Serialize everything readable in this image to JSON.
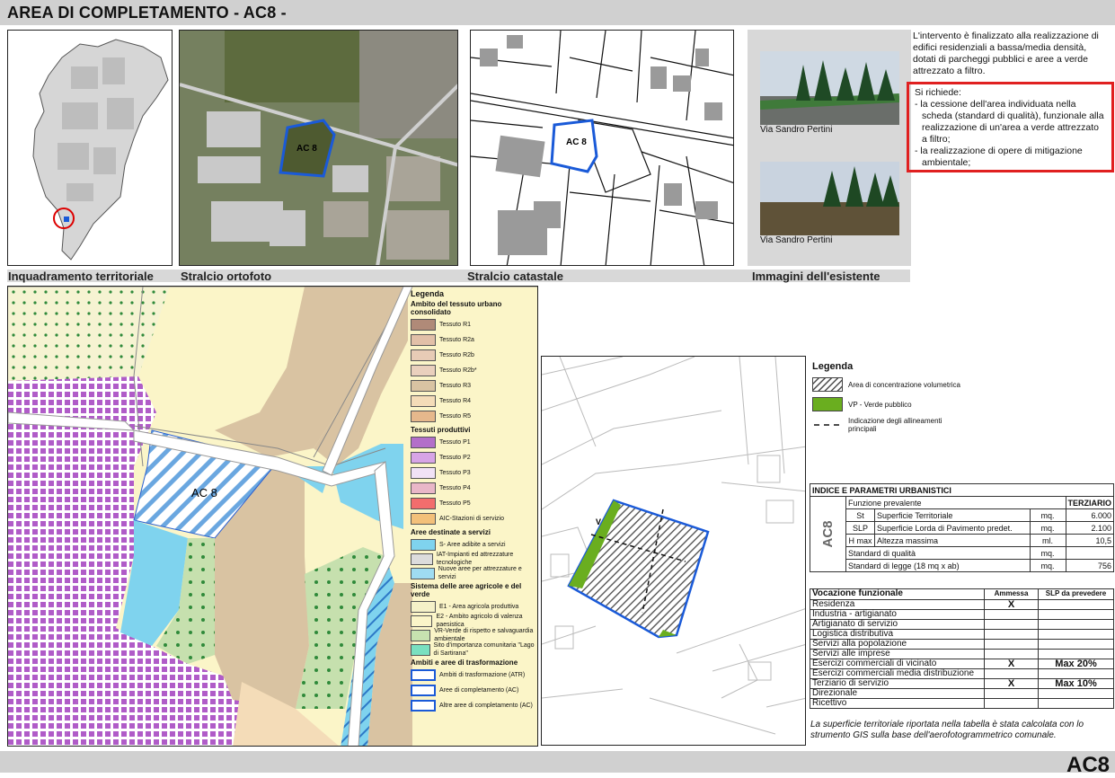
{
  "header": {
    "title": "AREA DI COMPLETAMENTO - AC8 -"
  },
  "captions": {
    "inquadramento": "Inquadramento territoriale",
    "ortofoto": "Stralcio ortofoto",
    "catastale": "Stralcio catastale",
    "esistente": "Immagini dell'esistente"
  },
  "map_labels": {
    "ortofoto": "AC 8",
    "catastale": "AC 8",
    "prg": "AC 8",
    "plan_v": "V"
  },
  "photos": [
    {
      "caption": "Via Sandro Pertini"
    },
    {
      "caption": "Via Sandro Pertini"
    }
  ],
  "description": "L'intervento è finalizzato alla realizzazione di edifici residenziali a bassa/media densità, dotati di parcheggi pubblici e aree a verde attrezzato a filtro.",
  "requirements": {
    "intro": "Si richiede:",
    "items": [
      "- la cessione dell'area individuata nella scheda (standard di qualità), funzionale alla realizzazione di un'area a verde attrezzato a filtro;",
      "- la realizzazione di opere di mitigazione ambientale;"
    ]
  },
  "legend_prg": {
    "title": "Legenda",
    "groups": [
      {
        "title": "Ambito del tessuto urbano consolidato",
        "items": [
          {
            "label": "Tessuto R1",
            "color": "#b08a78"
          },
          {
            "label": "Tessuto R2a",
            "color": "#e2c0a8"
          },
          {
            "label": "Tessuto R2b",
            "color": "#e8cbb6"
          },
          {
            "label": "Tessuto R2b*",
            "color": "#ead0bd"
          },
          {
            "label": "Tessuto R3",
            "color": "#d9c3a2"
          },
          {
            "label": "Tessuto R4",
            "color": "#f4dcb8"
          },
          {
            "label": "Tessuto R5",
            "color": "#e6b88c"
          }
        ]
      },
      {
        "title": "Tessuti produttivi",
        "items": [
          {
            "label": "Tessuto P1",
            "color": "#b36fc9"
          },
          {
            "label": "Tessuto P2",
            "color": "#d7a4e6"
          },
          {
            "label": "Tessuto P3",
            "color": "#f1e2f6"
          },
          {
            "label": "Tessuto P4",
            "color": "#e9b7c8"
          },
          {
            "label": "Tessuto P5",
            "color": "#f26d6d"
          },
          {
            "label": "AIC-Stazioni di servizio",
            "color": "#f3c07a"
          }
        ]
      },
      {
        "title": "Aree destinate a servizi",
        "items": [
          {
            "label": "S- Aree adibite a servizi",
            "color": "#7fd3ee"
          },
          {
            "label": "IAT-Impianti ed attrezzature tecnologiche",
            "color": "#dcdcdc"
          },
          {
            "label": "Nuove aree per attrezzature e servizi",
            "color": "#9fdcf2"
          }
        ]
      },
      {
        "title": "Sistema delle aree agricole e del verde",
        "items": [
          {
            "label": "E1 - Area agricola produttiva",
            "color": "#f5f1c8"
          },
          {
            "label": "E2 - Ambito agricolo di valenza paesistica",
            "color": "#fbf5c8"
          },
          {
            "label": "VR-Verde di rispetto e salvaguardia ambientale",
            "color": "#c7e2b0"
          },
          {
            "label": "Sito d'importanza comunitaria \"Lago di Sartirana\"",
            "color": "#79e0c0"
          }
        ]
      },
      {
        "title": "Ambiti e aree di trasformazione",
        "items": [
          {
            "label": "Ambiti di trasformazione (ATR)",
            "color": "#ffffff"
          },
          {
            "label": "Aree di completamento (AC)",
            "color": "#ffffff"
          },
          {
            "label": "Altre aree di completamento (AC)",
            "color": "#ffffff"
          }
        ]
      }
    ]
  },
  "legend_plan": {
    "title": "Legenda",
    "items": [
      {
        "label": "Area di concentrazione volumetrica"
      },
      {
        "label": "VP - Verde pubblico"
      },
      {
        "label": "Indicazione degli allineamenti principali"
      }
    ]
  },
  "params": {
    "title": "INDICE E PARAMETRI URBANISTICI",
    "side": "AC8",
    "funzione_label": "Funzione prevalente",
    "funzione_value": "TERZIARIO",
    "rows": [
      {
        "code": "St",
        "label": "Superficie Territoriale",
        "unit": "mq.",
        "value": "6.000"
      },
      {
        "code": "SLP",
        "label": "Superficie Lorda di Pavimento predet.",
        "unit": "mq.",
        "value": "2.100"
      },
      {
        "code": "H max",
        "label": "Altezza massima",
        "unit": "ml.",
        "value": "10,5"
      }
    ],
    "std_qualita": {
      "label": "Standard di qualità",
      "unit": "mq.",
      "value": ""
    },
    "std_legge": {
      "label": "Standard di legge (18 mq x ab)",
      "unit": "mq.",
      "value": "756"
    }
  },
  "vocazione": {
    "headers": [
      "Vocazione funzionale",
      "Ammessa",
      "SLP da prevedere"
    ],
    "rows": [
      [
        "Residenza",
        "X",
        ""
      ],
      [
        "Industria - artigianato",
        "",
        ""
      ],
      [
        "Artigianato di servizio",
        "",
        ""
      ],
      [
        "Logistica distributiva",
        "",
        ""
      ],
      [
        "Servizi alla popolazione",
        "",
        ""
      ],
      [
        "Servizi alle imprese",
        "",
        ""
      ],
      [
        "Esercizi commerciali di vicinato",
        "X",
        "Max 20%"
      ],
      [
        "Esercizi commerciali media distribuzione",
        "",
        ""
      ],
      [
        "Terziario di servizio",
        "X",
        "Max 10%"
      ],
      [
        "Direzionale",
        "",
        ""
      ],
      [
        "Ricettivo",
        "",
        ""
      ]
    ]
  },
  "note": "La superficie territoriale riportata nella tabella è stata calcolata con lo strumento GIS sulla base dell'aerofotogrammetrico comunale.",
  "footer": {
    "code": "AC8"
  }
}
